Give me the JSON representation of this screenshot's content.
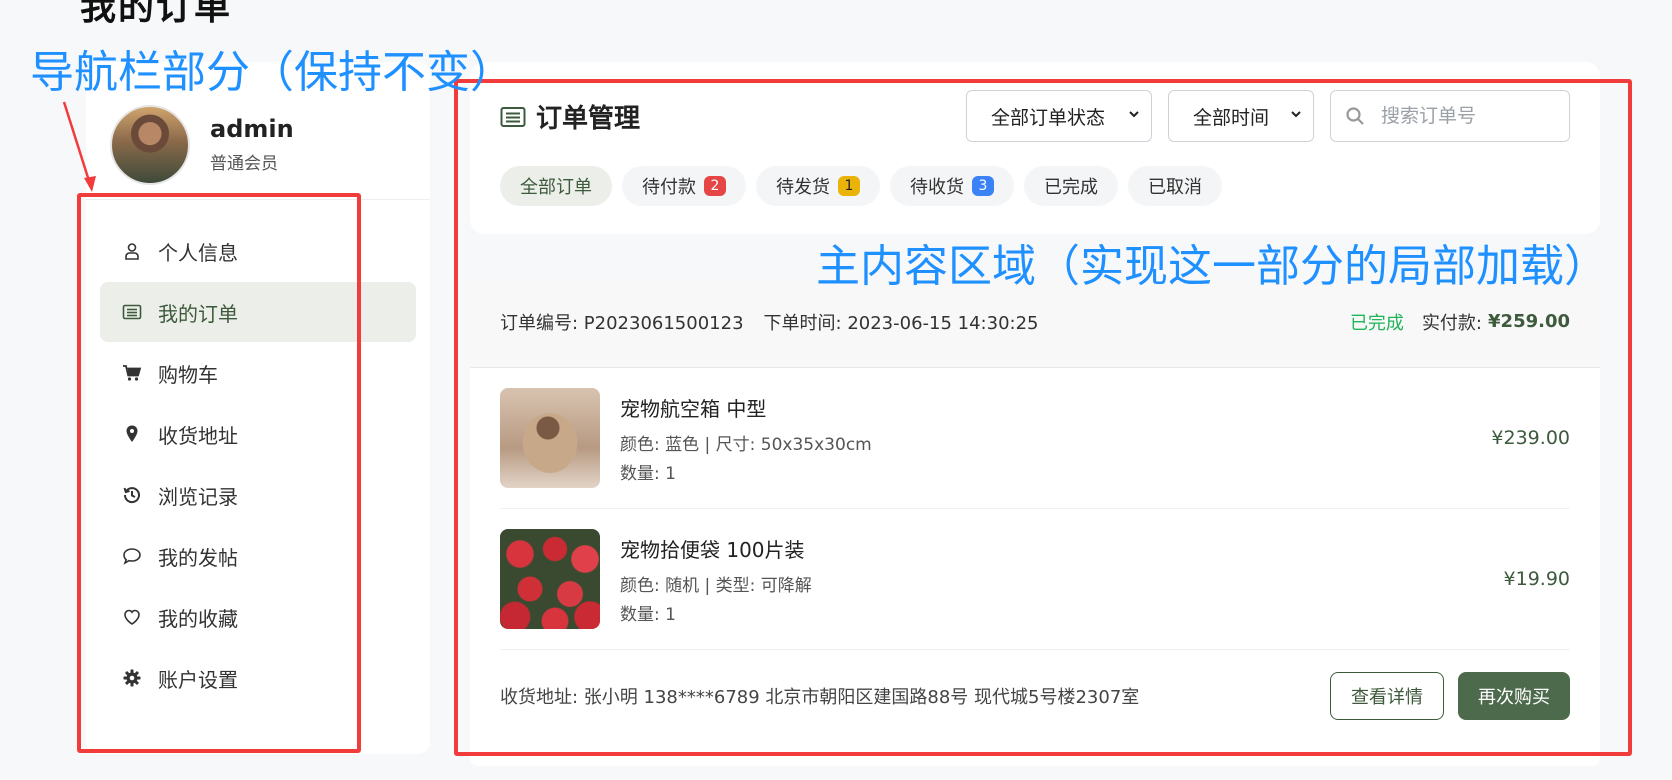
{
  "top_label": "我的订单",
  "annotations": {
    "nav_label": "导航栏部分（保持不变）",
    "main_label": "主内容区域（实现这一部分的局部加载）"
  },
  "user": {
    "name": "admin",
    "role": "普通会员"
  },
  "sidebar": {
    "items": [
      {
        "label": "个人信息",
        "icon": "user-icon"
      },
      {
        "label": "我的订单",
        "icon": "list-icon",
        "active": true
      },
      {
        "label": "购物车",
        "icon": "cart-icon"
      },
      {
        "label": "收货地址",
        "icon": "location-pin-icon"
      },
      {
        "label": "浏览记录",
        "icon": "history-icon"
      },
      {
        "label": "我的发帖",
        "icon": "comment-icon"
      },
      {
        "label": "我的收藏",
        "icon": "heart-icon"
      },
      {
        "label": "账户设置",
        "icon": "gear-icon"
      }
    ]
  },
  "main": {
    "title": "订单管理",
    "status_filter": "全部订单状态",
    "time_filter": "全部时间",
    "search_placeholder": "搜索订单号",
    "tabs": [
      {
        "label": "全部订单",
        "active": true
      },
      {
        "label": "待付款",
        "count": "2",
        "badge_color": "#e64545"
      },
      {
        "label": "待发货",
        "count": "1",
        "badge_color": "#eab308"
      },
      {
        "label": "待收货",
        "count": "3",
        "badge_color": "#3b82f6"
      },
      {
        "label": "已完成"
      },
      {
        "label": "已取消"
      }
    ]
  },
  "order": {
    "number_label": "订单编号: P2023061500123",
    "time_label": "下单时间: 2023-06-15 14:30:25",
    "status": "已完成",
    "paid_label": "实付款:",
    "paid_amount": "¥259.00",
    "items": [
      {
        "name": "宠物航空箱 中型",
        "spec": "颜色: 蓝色 | 尺寸: 50x35x30cm",
        "qty": "数量: 1",
        "price": "¥239.00"
      },
      {
        "name": "宠物拾便袋 100片装",
        "spec": "颜色: 随机 | 类型: 可降解",
        "qty": "数量: 1",
        "price": "¥19.90"
      }
    ],
    "address": "收货地址: 张小明 138****6789 北京市朝阳区建国路88号 现代城5号楼2307室",
    "detail_button": "查看详情",
    "rebuy_button": "再次购买"
  },
  "colors": {
    "accent": "#3d5a3c",
    "annotation": "#1e90ff",
    "highlight_box": "#f23c3c"
  }
}
